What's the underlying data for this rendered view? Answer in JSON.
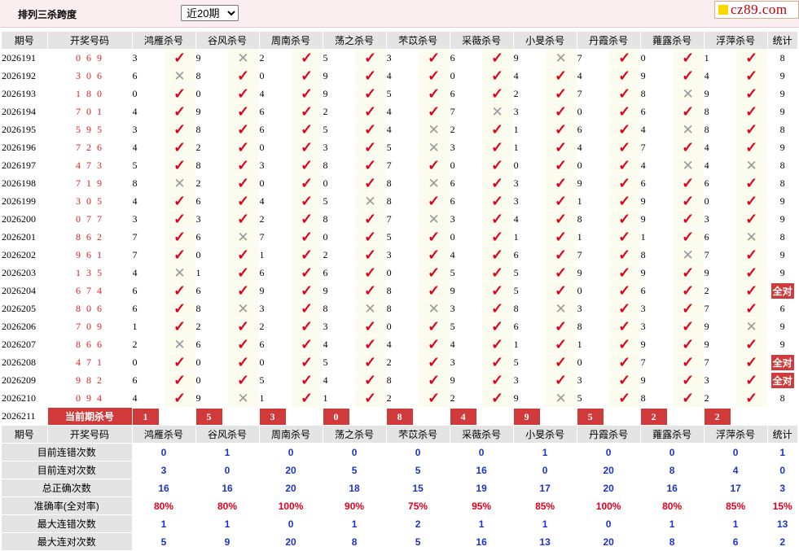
{
  "title": "排列三杀跨度",
  "period_select": {
    "selected": "近20期"
  },
  "logo": {
    "text": "cz89.com"
  },
  "colors": {
    "accent_red": "#d03a3a",
    "check_red": "#e0001b",
    "stat_blue": "#1a35c2",
    "header_gray": "#e4e4e4"
  },
  "headers": {
    "issue": "期号",
    "nums": "开奖号码",
    "count": "统计",
    "experts": [
      "鸿雁杀号",
      "谷风杀号",
      "周南杀号",
      "荡之杀号",
      "芣苡杀号",
      "采薇杀号",
      "小旻杀号",
      "丹霞杀号",
      "蕹露杀号",
      "浮萍杀号"
    ]
  },
  "rows": [
    {
      "issue": "2026191",
      "nums": "0 6 9",
      "kills": [
        3,
        9,
        2,
        5,
        3,
        6,
        9,
        7,
        0,
        1
      ],
      "ok": [
        1,
        0,
        1,
        1,
        1,
        1,
        0,
        1,
        1,
        1
      ],
      "count": "8"
    },
    {
      "issue": "2026192",
      "nums": "3 0 6",
      "kills": [
        6,
        8,
        0,
        9,
        4,
        0,
        4,
        4,
        9,
        4
      ],
      "ok": [
        0,
        1,
        1,
        1,
        1,
        1,
        1,
        1,
        1,
        1
      ],
      "count": "9"
    },
    {
      "issue": "2026193",
      "nums": "1 8 0",
      "kills": [
        0,
        0,
        4,
        9,
        5,
        6,
        2,
        7,
        8,
        9
      ],
      "ok": [
        1,
        1,
        1,
        1,
        1,
        1,
        1,
        1,
        0,
        1
      ],
      "count": "9"
    },
    {
      "issue": "2026194",
      "nums": "7 0 1",
      "kills": [
        4,
        9,
        6,
        2,
        4,
        7,
        3,
        0,
        6,
        8
      ],
      "ok": [
        1,
        1,
        1,
        1,
        1,
        0,
        1,
        1,
        1,
        1
      ],
      "count": "9"
    },
    {
      "issue": "2026195",
      "nums": "5 9 5",
      "kills": [
        3,
        8,
        6,
        5,
        4,
        2,
        1,
        6,
        4,
        8
      ],
      "ok": [
        1,
        1,
        1,
        1,
        0,
        1,
        1,
        1,
        0,
        1
      ],
      "count": "8"
    },
    {
      "issue": "2026196",
      "nums": "7 2 6",
      "kills": [
        4,
        2,
        0,
        3,
        5,
        3,
        1,
        4,
        7,
        4
      ],
      "ok": [
        1,
        1,
        1,
        1,
        0,
        1,
        1,
        1,
        1,
        1
      ],
      "count": "9"
    },
    {
      "issue": "2026197",
      "nums": "4 7 3",
      "kills": [
        5,
        8,
        3,
        8,
        7,
        0,
        0,
        0,
        4,
        4
      ],
      "ok": [
        1,
        1,
        1,
        1,
        1,
        1,
        1,
        1,
        0,
        0
      ],
      "count": "8"
    },
    {
      "issue": "2026198",
      "nums": "7 1 9",
      "kills": [
        8,
        2,
        0,
        0,
        8,
        6,
        3,
        9,
        6,
        6
      ],
      "ok": [
        0,
        1,
        1,
        1,
        0,
        1,
        1,
        1,
        1,
        1
      ],
      "count": "8"
    },
    {
      "issue": "2026199",
      "nums": "3 0 5",
      "kills": [
        4,
        6,
        4,
        5,
        8,
        6,
        3,
        1,
        9,
        0
      ],
      "ok": [
        1,
        1,
        1,
        0,
        1,
        1,
        1,
        1,
        1,
        1
      ],
      "count": "9"
    },
    {
      "issue": "2026200",
      "nums": "0 7 7",
      "kills": [
        3,
        3,
        2,
        8,
        7,
        3,
        4,
        8,
        9,
        3
      ],
      "ok": [
        1,
        1,
        1,
        1,
        0,
        1,
        1,
        1,
        1,
        1
      ],
      "count": "9"
    },
    {
      "issue": "2026201",
      "nums": "8 6 2",
      "kills": [
        7,
        6,
        7,
        0,
        5,
        0,
        1,
        1,
        1,
        6
      ],
      "ok": [
        1,
        0,
        1,
        1,
        1,
        1,
        1,
        1,
        1,
        0
      ],
      "count": "8"
    },
    {
      "issue": "2026202",
      "nums": "9 6 1",
      "kills": [
        7,
        0,
        1,
        2,
        3,
        4,
        6,
        7,
        8,
        7
      ],
      "ok": [
        1,
        1,
        1,
        1,
        1,
        1,
        1,
        1,
        0,
        1
      ],
      "count": "9"
    },
    {
      "issue": "2026203",
      "nums": "1 3 5",
      "kills": [
        4,
        1,
        6,
        6,
        0,
        5,
        5,
        9,
        9,
        9
      ],
      "ok": [
        0,
        1,
        1,
        1,
        1,
        1,
        1,
        1,
        1,
        1
      ],
      "count": "9"
    },
    {
      "issue": "2026204",
      "nums": "6 7 4",
      "kills": [
        6,
        6,
        9,
        9,
        8,
        9,
        5,
        0,
        6,
        2
      ],
      "ok": [
        1,
        1,
        1,
        1,
        1,
        1,
        1,
        1,
        1,
        1
      ],
      "count": "全对"
    },
    {
      "issue": "2026205",
      "nums": "8 0 6",
      "kills": [
        6,
        8,
        3,
        8,
        8,
        3,
        8,
        3,
        3,
        7
      ],
      "ok": [
        1,
        0,
        1,
        0,
        0,
        1,
        0,
        1,
        1,
        1
      ],
      "count": "6"
    },
    {
      "issue": "2026206",
      "nums": "7 0 9",
      "kills": [
        1,
        2,
        2,
        3,
        0,
        5,
        6,
        8,
        3,
        9
      ],
      "ok": [
        1,
        1,
        1,
        1,
        1,
        1,
        1,
        1,
        1,
        0
      ],
      "count": "9"
    },
    {
      "issue": "2026207",
      "nums": "8 6 6",
      "kills": [
        2,
        6,
        6,
        4,
        4,
        4,
        1,
        1,
        9,
        9
      ],
      "ok": [
        0,
        1,
        1,
        1,
        1,
        1,
        1,
        1,
        1,
        1
      ],
      "count": "9"
    },
    {
      "issue": "2026208",
      "nums": "4 7 1",
      "kills": [
        0,
        0,
        0,
        5,
        2,
        3,
        5,
        0,
        7,
        7
      ],
      "ok": [
        1,
        1,
        1,
        1,
        1,
        1,
        1,
        1,
        1,
        1
      ],
      "count": "全对"
    },
    {
      "issue": "2026209",
      "nums": "9 8 2",
      "kills": [
        6,
        0,
        5,
        4,
        8,
        9,
        3,
        3,
        9,
        3
      ],
      "ok": [
        1,
        1,
        1,
        1,
        1,
        1,
        1,
        1,
        1,
        1
      ],
      "count": "全对"
    },
    {
      "issue": "2026210",
      "nums": "0 9 4",
      "kills": [
        4,
        9,
        1,
        1,
        2,
        2,
        9,
        5,
        8,
        2
      ],
      "ok": [
        1,
        0,
        1,
        1,
        1,
        1,
        0,
        1,
        1,
        1
      ],
      "count": "8"
    }
  ],
  "current": {
    "issue": "2026211",
    "label": "当前期杀号",
    "kills": [
      "1",
      "5",
      "3",
      "0",
      "8",
      "4",
      "9",
      "5",
      "2",
      "2"
    ]
  },
  "stats": [
    {
      "label": "目前连错次数",
      "values": [
        "0",
        "1",
        "0",
        "0",
        "0",
        "0",
        "1",
        "0",
        "0",
        "0",
        "1"
      ]
    },
    {
      "label": "目前连对次数",
      "values": [
        "3",
        "0",
        "20",
        "5",
        "5",
        "16",
        "0",
        "20",
        "8",
        "4",
        "0"
      ]
    },
    {
      "label": "总正确次数",
      "values": [
        "16",
        "16",
        "20",
        "18",
        "15",
        "19",
        "17",
        "20",
        "16",
        "17",
        "3"
      ]
    },
    {
      "label": "准确率(全对率)",
      "values": [
        "80%",
        "80%",
        "100%",
        "90%",
        "75%",
        "95%",
        "85%",
        "100%",
        "80%",
        "85%",
        "15%"
      ],
      "rate": true
    },
    {
      "label": "最大连错次数",
      "values": [
        "1",
        "1",
        "0",
        "1",
        "2",
        "1",
        "1",
        "0",
        "1",
        "1",
        "13"
      ]
    },
    {
      "label": "最大连对次数",
      "values": [
        "5",
        "9",
        "20",
        "8",
        "5",
        "16",
        "13",
        "20",
        "8",
        "6",
        "2"
      ]
    }
  ]
}
